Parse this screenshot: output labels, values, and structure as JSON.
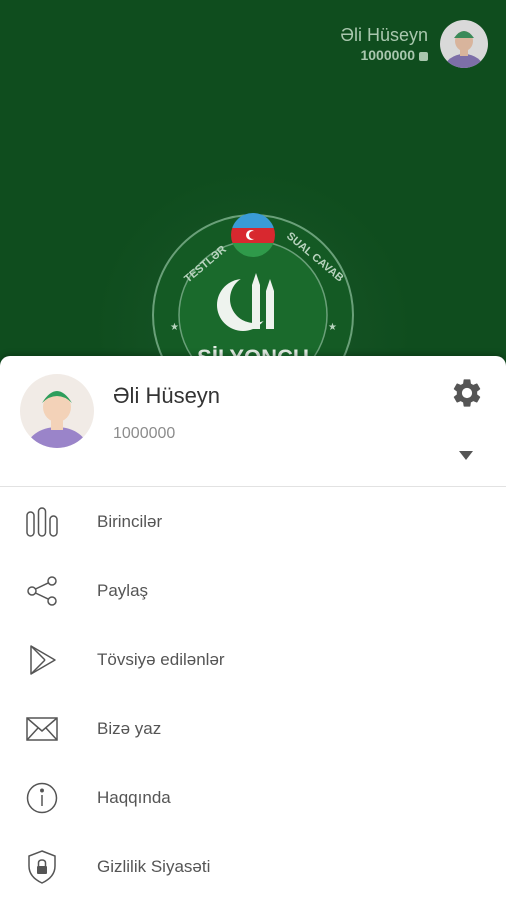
{
  "header": {
    "user_name": "Əli Hüseyn",
    "user_score": "1000000"
  },
  "logo": {
    "arc_left": "TESTLƏR",
    "arc_right": "SUAL CAVAB",
    "bottom_text": "ŞİLYONÇU"
  },
  "drawer": {
    "user_name": "Əli Hüseyn",
    "user_score": "1000000",
    "menu": [
      {
        "label": "Birincilər",
        "icon": "leaderboard-icon"
      },
      {
        "label": "Paylaş",
        "icon": "share-icon"
      },
      {
        "label": "Tövsiyə edilənlər",
        "icon": "play-store-icon"
      },
      {
        "label": "Bizə yaz",
        "icon": "mail-icon"
      },
      {
        "label": "Haqqında",
        "icon": "info-icon"
      },
      {
        "label": "Gizlilik Siyasəti",
        "icon": "privacy-lock-icon"
      }
    ]
  },
  "colors": {
    "primary_green": "#0f4d1e",
    "avatar_shirt": "#9a84c9",
    "avatar_cap": "#2e9e5c",
    "skin": "#f3d2b8"
  }
}
